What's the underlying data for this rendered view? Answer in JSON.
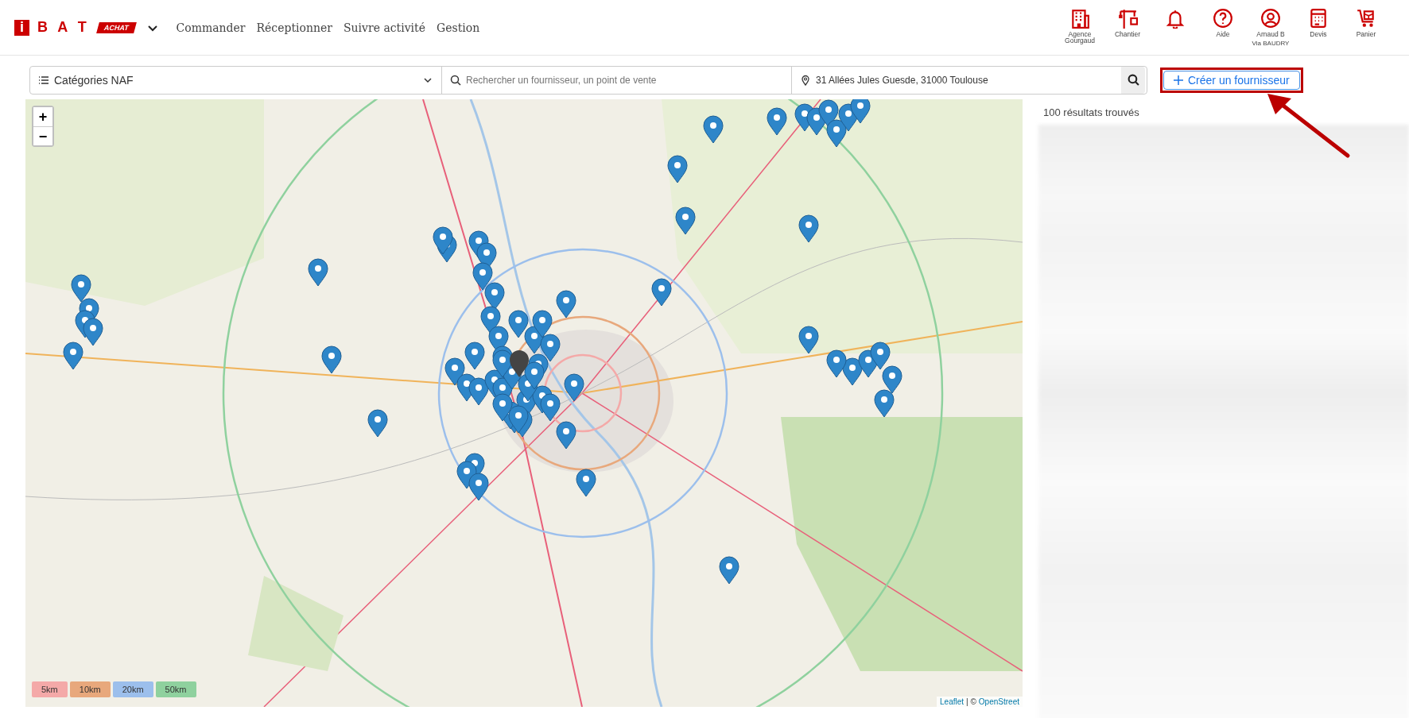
{
  "header": {
    "logo": {
      "mark": "i",
      "brand": "B A T",
      "tag": "ACHAT"
    },
    "nav": [
      "Commander",
      "Réceptionner",
      "Suivre activité",
      "Gestion"
    ],
    "tools": [
      {
        "kind": "building",
        "label": "Agence Gourgaud"
      },
      {
        "kind": "crane",
        "label": "Chantier"
      },
      {
        "kind": "bell"
      },
      {
        "kind": "help",
        "label": "Aide"
      },
      {
        "kind": "user",
        "label": "Arnaud B",
        "sublabel": "Via BAUDRY"
      },
      {
        "kind": "calculator",
        "label": "Devis"
      },
      {
        "kind": "cart",
        "label": "Panier"
      }
    ]
  },
  "search": {
    "category": "Catégories NAF",
    "placeholder": "Rechercher un fournisseur, un point de vente",
    "address": "31 Allées Jules Guesde, 31000 Toulouse",
    "create_button": "Créer un fournisseur"
  },
  "map": {
    "zoom_in": "+",
    "zoom_out": "−",
    "radii": [
      {
        "label": "5km",
        "color": "#f4a9a8"
      },
      {
        "label": "10km",
        "color": "#e8a87c"
      },
      {
        "label": "20km",
        "color": "#9cbfec"
      },
      {
        "label": "50km",
        "color": "#8fd19e"
      }
    ],
    "attribution": {
      "link": "Leaflet",
      "separator": "| ©",
      "source": "OpenStreet"
    }
  },
  "results": {
    "count": "100 résultats trouvés"
  }
}
